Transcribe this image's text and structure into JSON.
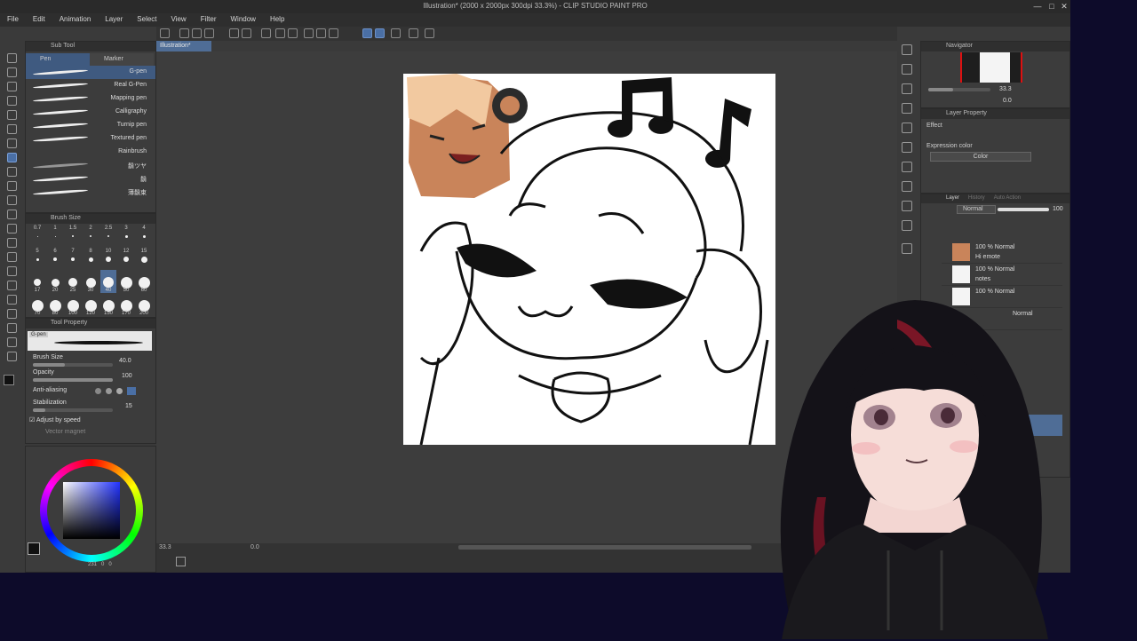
{
  "window": {
    "title": "Illustration* (2000 x 2000px 300dpi 33.3%) - CLIP STUDIO PAINT PRO",
    "controls": [
      "—",
      "□",
      "✕"
    ]
  },
  "menu": [
    "File",
    "Edit",
    "Animation",
    "Layer",
    "Select",
    "View",
    "Filter",
    "Window",
    "Help"
  ],
  "canvas_tab": "Illustration*",
  "subtool": {
    "panel_title": "Sub Tool",
    "tabs": [
      "Pen",
      "Marker"
    ],
    "brushes": [
      {
        "label": "G-pen",
        "selected": true
      },
      {
        "label": "Real G-Pen"
      },
      {
        "label": "Mapping pen"
      },
      {
        "label": "Calligraphy"
      },
      {
        "label": "Turnip pen"
      },
      {
        "label": "Textured pen"
      },
      {
        "label": "Rainbrush"
      },
      {
        "label": "鬍ツヤ"
      },
      {
        "label": "鬍"
      },
      {
        "label": "薄鬍束"
      }
    ]
  },
  "brush_size_panel": {
    "title": "Brush Size",
    "sizes_row1": [
      "0.7",
      "1",
      "1.5",
      "2",
      "2.5",
      "3",
      "4"
    ],
    "sizes_row2": [
      "5",
      "6",
      "7",
      "8",
      "10",
      "12",
      "15"
    ],
    "sizes_row3": [
      "17",
      "20",
      "25",
      "30",
      "40",
      "50",
      "60"
    ],
    "sizes_row4": [
      "70",
      "80",
      "100",
      "120",
      "150",
      "170",
      "200"
    ],
    "selected": "40"
  },
  "tool_property": {
    "title": "Tool Property",
    "preview_label": "G-pen",
    "brush_size_label": "Brush Size",
    "brush_size_value": "40.0",
    "opacity_label": "Opacity",
    "opacity_value": "100",
    "antialias_label": "Anti-aliasing",
    "stabilization_label": "Stabilization",
    "stabilization_value": "15",
    "adjust_label": "Adjust by speed",
    "vector_label": "Vector magnet"
  },
  "color": {
    "readout": [
      "231",
      "0",
      "0"
    ]
  },
  "navigator": {
    "title": "Navigator",
    "zoom": "33.3",
    "angle": "0.0"
  },
  "layer_property": {
    "title": "Layer Property",
    "effect_label": "Effect",
    "expression_label": "Expression color",
    "expression_value": "Color"
  },
  "layer_panel": {
    "tabs": [
      "Layer",
      "History",
      "Auto Action"
    ],
    "blend_mode": "Normal",
    "opacity": "100",
    "layers": [
      {
        "blend": "100 % Normal",
        "name": "Hi emote"
      },
      {
        "blend": "100 % Normal",
        "name": "notes"
      },
      {
        "blend": "100 % Normal",
        "name": ""
      },
      {
        "blend": "Normal",
        "name": ""
      }
    ]
  },
  "status_bar": {
    "zoom": "33.3",
    "angle": "0.0"
  },
  "colors": {
    "accent": "#4a6fa5",
    "background": "#3a3a3a",
    "stream_bg": "#0d0b2a"
  }
}
